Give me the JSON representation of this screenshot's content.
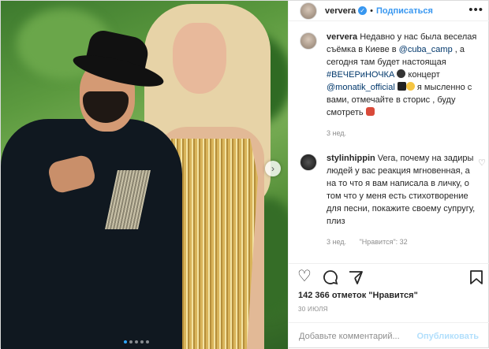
{
  "post": {
    "author": {
      "username": "ververa",
      "verified": true
    },
    "header": {
      "separator": "•",
      "follow_label": "Подписаться",
      "more_icon": "more-icon"
    },
    "caption": {
      "username": "ververa",
      "text_1": "Недавно у нас была веселая съёмка в Киеве в ",
      "mention_1": "@cuba_camp",
      "text_2": " , а сегодня там будет настоящая ",
      "hashtag": "#ВЕЧЕРиНОЧКА",
      "text_3": " концерт ",
      "mention_2": "@monatik_official",
      "text_4": " я мысленно с вами, отмечайте в сторис , буду смотреть",
      "time": "3 нед."
    },
    "comments": [
      {
        "username": "stylinhippin",
        "text": "Vera, почему на задиры людей у вас реакция мгновенная, а на то что я вам написала в личку, о том что у меня есть стихотворение для песни, покажите своему супругу, плиз",
        "time": "3 нед.",
        "likes_label": "\"Нравится\": 32"
      }
    ],
    "likes": "142 366 отметок \"Нравится\"",
    "date": "30 ИЮЛЯ",
    "add_comment": {
      "placeholder": "Добавьте комментарий...",
      "publish_label": "Опубликовать"
    },
    "carousel": {
      "total": 5,
      "current": 1
    },
    "colors": {
      "accent": "#3897f0",
      "publish_disabled": "#b2dffc",
      "mention": "#00376b"
    }
  }
}
